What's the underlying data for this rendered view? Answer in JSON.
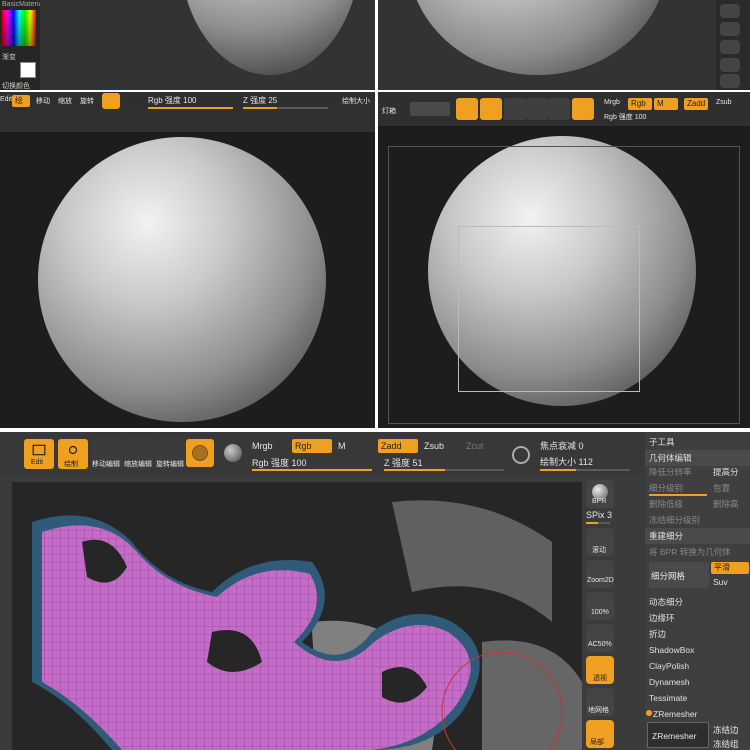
{
  "panel1": {
    "material": "BasicMaterial",
    "label_a": "渐变",
    "label_b": "切换颜色"
  },
  "panel2": {
    "toolbar": {
      "edit": "Edit",
      "draw": "绘制",
      "move": "移动",
      "scale": "缩放",
      "rotate": "旋转",
      "rgb_intensity": "Rgb 强度 100",
      "z_intensity": "Z 强度 25",
      "draw_size": "绘制大小"
    }
  },
  "panel3": {
    "toolbar": {
      "edit": "Edit",
      "draw": "绘制",
      "move": "移动",
      "scale": "缩放",
      "rotate": "旋转",
      "mrgb": "Mrgb",
      "rgb": "Rgb",
      "m": "M",
      "zadd": "Zadd",
      "zsub": "Zsub",
      "rgb_intensity": "Rgb 强度 100"
    }
  },
  "panel4": {
    "toolbar": {
      "edit": "Edit",
      "draw": "绘制",
      "move": "移动编辑",
      "scale": "缩放编辑",
      "rotate": "旋转编辑",
      "mrgb": "Mrgb",
      "rgb": "Rgb",
      "m": "M",
      "zadd": "Zadd",
      "zsub": "Zsub",
      "zcut": "Zcut",
      "rgb_intensity": "Rgb 强度 100",
      "z_intensity": "Z 强度 51",
      "focal_shift": "焦点衰减 0",
      "draw_size": "绘制大小 112"
    },
    "rgb_intensity_value": 100,
    "z_intensity_value": 51,
    "draw_size_value": 112,
    "side": {
      "bpr": "BPR",
      "spix": "SPix 3",
      "scroll": "滚动",
      "zoom2d": "Zoom2D",
      "zoom100": "100%",
      "ac50": "AC50%",
      "persp": "透视",
      "floor": "地网格",
      "local": "局部"
    },
    "tool_panel": {
      "title": "子工具",
      "section": "几何体编辑",
      "lower_res": "降低分辨率",
      "higher_res": "提高分",
      "subdiv_level": "细分级别",
      "cage": "包置",
      "del_lower": "删除低级",
      "del_higher": "删除高",
      "freeze_subdiv": "冻结细分级别",
      "reconstruct": "重建细分",
      "convert_bpr": "将 BPR 转换为几何体",
      "divide": "细分网格",
      "smooth": "平滑",
      "suv": "Suv",
      "dynamic_subdiv": "动态细分",
      "edge_loop": "边缘环",
      "crease": "折边",
      "shadowbox": "ShadowBox",
      "claypolish": "ClayPolish",
      "dynamesh": "Dynamesh",
      "tessimate": "Tessimate",
      "zremesher_header": "ZRemesher",
      "zremesher_btn": "ZRemesher",
      "freeze_border": "冻结边",
      "freeze_groups": "冻结组"
    }
  },
  "colors": {
    "accent": "#f0a020",
    "mesh": "#c878d0",
    "mesh_side": "#2f5a78",
    "panel": "#3a3a3a"
  }
}
